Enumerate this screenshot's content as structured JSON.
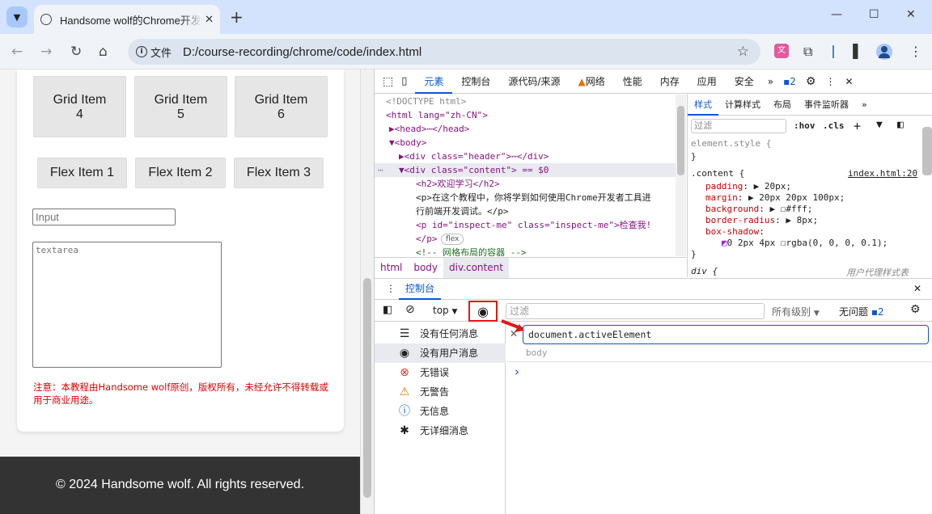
{
  "browser": {
    "tab_title": "Handsome wolf的Chrome开发者工具教程",
    "tab_close": "✕",
    "new_tab": "+",
    "omnibox": {
      "chip": "文件",
      "url": "D:/course-recording/chrome/code/index.html"
    },
    "window_controls": [
      "—",
      "☐",
      "✕"
    ]
  },
  "page": {
    "grid_items": [
      "Grid Item\n4",
      "Grid Item\n5",
      "Grid Item\n6"
    ],
    "flex_items": [
      "Flex Item 1",
      "Flex Item 2",
      "Flex Item 3"
    ],
    "input_placeholder": "Input",
    "textarea_placeholder": "textarea",
    "notice": "注意：本教程由Handsome wolf原创，版权所有，未经允许不得转载或用于商业用途。",
    "footer": "© 2024 Handsome wolf. All rights reserved."
  },
  "devtools": {
    "tabs": [
      "元素",
      "控制台",
      "源代码/来源",
      "网络",
      "性能",
      "内存",
      "应用",
      "安全"
    ],
    "issues_count": "2",
    "elements": {
      "lines": [
        {
          "t": "<!DOCTYPE html>"
        },
        {
          "t": "<html lang=\"zh-CN\">"
        },
        {
          "t": "▶<head>⋯</head>"
        },
        {
          "t": "▼<body>"
        },
        {
          "t": "▶<div class=\"header\">⋯</div>"
        },
        {
          "t": "▼<div class=\"content\"> == $0"
        },
        {
          "t": "<h2>欢迎学习</h2>"
        },
        {
          "t": "<p>在这个教程中，你将学到如何使用Chrome开发者工具进"
        },
        {
          "t": "行前端开发调试。</p>"
        },
        {
          "t": "<p id=\"inspect-me\" class=\"inspect-me\">检查我!"
        },
        {
          "t": "</p>"
        },
        {
          "t": "<!-- 网格布局的容器 -->"
        }
      ],
      "flex_badge": "flex",
      "breadcrumbs": [
        "html",
        "body",
        "div.content"
      ]
    },
    "styles": {
      "tabs": [
        "样式",
        "计算样式",
        "布局",
        "事件监听器"
      ],
      "filter_placeholder": "过滤",
      "hov": ":hov",
      "cls": ".cls",
      "element_style": "element.style {",
      "close_brace": "}",
      "rule_selector": ".content {",
      "rule_source": "index.html:20",
      "props": [
        {
          "name": "padding",
          "value": "▶ 20px;"
        },
        {
          "name": "margin",
          "value": "▶ 20px 20px 100px;"
        },
        {
          "name": "background",
          "value": "▶ ☐#fff;"
        },
        {
          "name": "border-radius",
          "value": "▶ 8px;"
        },
        {
          "name": "box-shadow",
          "value": ""
        }
      ],
      "box_shadow_value": "0 2px 4px ☐rgba(0, 0, 0, 0.1);",
      "next_selector": "div {",
      "next_source": "用户代理样式表"
    },
    "console": {
      "drawer_tab": "控制台",
      "context": "top",
      "filter_placeholder": "过滤",
      "levels": "所有级别",
      "issues_text": "无问题",
      "issues_count": "2",
      "sidebar": [
        {
          "icon": "list-icon",
          "label": "没有任何消息"
        },
        {
          "icon": "user-icon",
          "label": "没有用户消息"
        },
        {
          "icon": "error-icon",
          "label": "无错误"
        },
        {
          "icon": "warning-icon",
          "label": "无警告"
        },
        {
          "icon": "info-icon",
          "label": "无信息"
        },
        {
          "icon": "bug-icon",
          "label": "无详细消息"
        }
      ],
      "live_expression": "document.activeElement",
      "live_result": "body",
      "prompt": "›"
    }
  }
}
